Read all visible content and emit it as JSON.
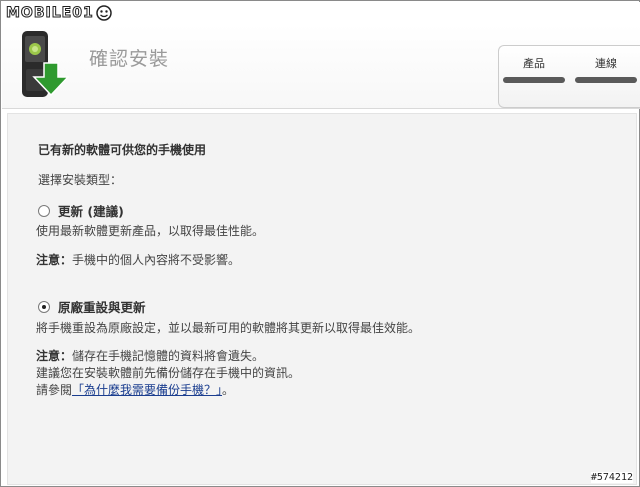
{
  "site_logo": "MOBILE01",
  "header": {
    "title": "確認安裝",
    "status": [
      {
        "label": "產品"
      },
      {
        "label": "連線"
      }
    ]
  },
  "main": {
    "heading": "已有新的軟體可供您的手機使用",
    "subheading": "選擇安裝類型：",
    "option_update": {
      "label": "更新 (建議)",
      "selected": false,
      "description": "使用最新軟體更新產品，以取得最佳性能。",
      "note_label": "注意：",
      "note_text": "手機中的個人內容將不受影響。"
    },
    "option_reset": {
      "label": "原廠重設與更新",
      "selected": true,
      "description": "將手機重設為原廠設定，並以最新可用的軟體將其更新以取得最佳效能。",
      "note_label": "注意：",
      "note_text": "儲存在手機記憶體的資料將會遺失。",
      "note_line2": "建議您在安裝軟體前先備份儲存在手機中的資訊。",
      "note_line3_prefix": "請參閱",
      "note_link": "「為什麼我需要備份手機？」",
      "note_line3_suffix": "。"
    }
  },
  "watermark": "#574212",
  "colors": {
    "link": "#1a3d8f",
    "title_gray": "#9a9a9a",
    "bar": "#5a5a5a"
  }
}
